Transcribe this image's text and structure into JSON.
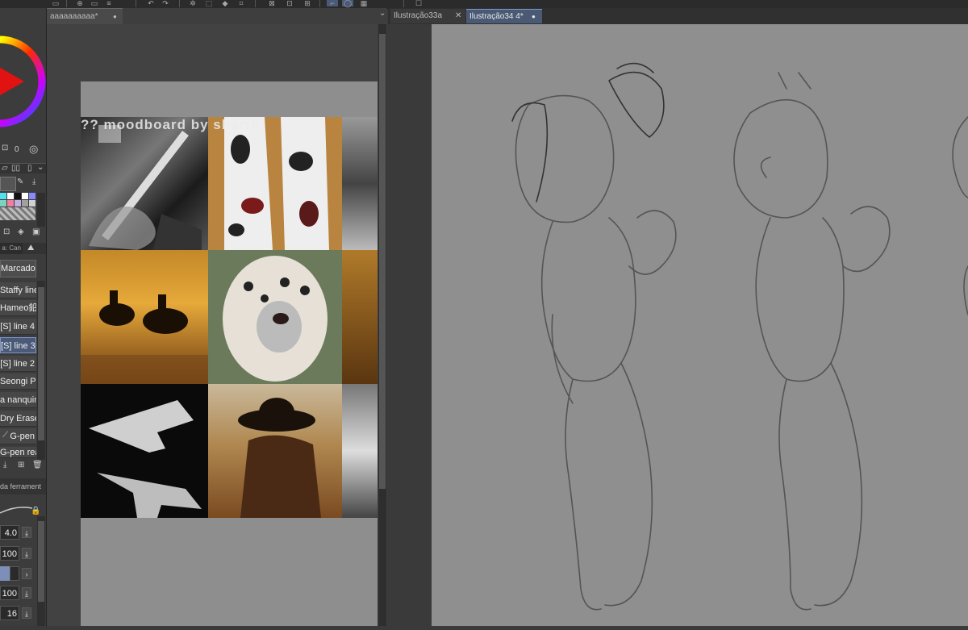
{
  "left_panel": {
    "brush_list": [
      {
        "label": "Marcador",
        "selected": false
      },
      {
        "label": "Staffy lines",
        "selected": false
      },
      {
        "label": "Hameo鉛筆",
        "selected": false
      },
      {
        "label": "[S] line 4",
        "selected": false
      },
      {
        "label": "[S] line 3",
        "selected": true
      },
      {
        "label": "[S] line 2",
        "selected": false
      },
      {
        "label": "Seongi Pen",
        "selected": false
      },
      {
        "label": "a nanquin",
        "selected": false
      },
      {
        "label": "Dry Eraser",
        "selected": false
      },
      {
        "label": "G-pen",
        "selected": false
      },
      {
        "label": "G-pen real",
        "selected": false
      }
    ],
    "subtool_tab": "a: Can",
    "color_count": "0",
    "tool_property_label": "da ferrament",
    "brush_size": "4.0",
    "opacity": "100",
    "value3": "100",
    "value4": "16"
  },
  "middle_doc": {
    "tab_title": "aaaaaaaaaa*",
    "moodboard_watermark": "?? moodboard by sharrk"
  },
  "right_doc": {
    "tabs": [
      {
        "label": "Ilustração33a",
        "active": false
      },
      {
        "label": "Ilustração34 4*",
        "active": true
      }
    ]
  },
  "colors": {
    "accent": "#7e95c7",
    "canvas_gray": "#8f8f8f",
    "panel": "#3c3c3c"
  }
}
